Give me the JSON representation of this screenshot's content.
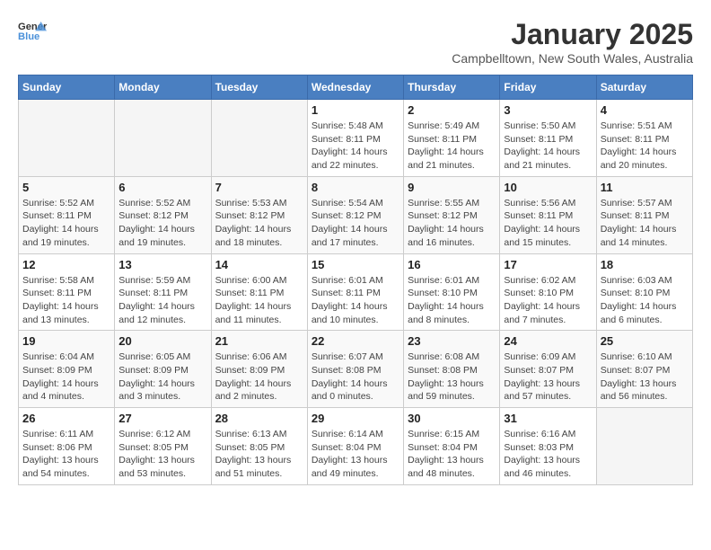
{
  "header": {
    "logo_line1": "General",
    "logo_line2": "Blue",
    "month_year": "January 2025",
    "location": "Campbelltown, New South Wales, Australia"
  },
  "days_of_week": [
    "Sunday",
    "Monday",
    "Tuesday",
    "Wednesday",
    "Thursday",
    "Friday",
    "Saturday"
  ],
  "weeks": [
    [
      {
        "day": "",
        "info": ""
      },
      {
        "day": "",
        "info": ""
      },
      {
        "day": "",
        "info": ""
      },
      {
        "day": "1",
        "info": "Sunrise: 5:48 AM\nSunset: 8:11 PM\nDaylight: 14 hours\nand 22 minutes."
      },
      {
        "day": "2",
        "info": "Sunrise: 5:49 AM\nSunset: 8:11 PM\nDaylight: 14 hours\nand 21 minutes."
      },
      {
        "day": "3",
        "info": "Sunrise: 5:50 AM\nSunset: 8:11 PM\nDaylight: 14 hours\nand 21 minutes."
      },
      {
        "day": "4",
        "info": "Sunrise: 5:51 AM\nSunset: 8:11 PM\nDaylight: 14 hours\nand 20 minutes."
      }
    ],
    [
      {
        "day": "5",
        "info": "Sunrise: 5:52 AM\nSunset: 8:11 PM\nDaylight: 14 hours\nand 19 minutes."
      },
      {
        "day": "6",
        "info": "Sunrise: 5:52 AM\nSunset: 8:12 PM\nDaylight: 14 hours\nand 19 minutes."
      },
      {
        "day": "7",
        "info": "Sunrise: 5:53 AM\nSunset: 8:12 PM\nDaylight: 14 hours\nand 18 minutes."
      },
      {
        "day": "8",
        "info": "Sunrise: 5:54 AM\nSunset: 8:12 PM\nDaylight: 14 hours\nand 17 minutes."
      },
      {
        "day": "9",
        "info": "Sunrise: 5:55 AM\nSunset: 8:12 PM\nDaylight: 14 hours\nand 16 minutes."
      },
      {
        "day": "10",
        "info": "Sunrise: 5:56 AM\nSunset: 8:11 PM\nDaylight: 14 hours\nand 15 minutes."
      },
      {
        "day": "11",
        "info": "Sunrise: 5:57 AM\nSunset: 8:11 PM\nDaylight: 14 hours\nand 14 minutes."
      }
    ],
    [
      {
        "day": "12",
        "info": "Sunrise: 5:58 AM\nSunset: 8:11 PM\nDaylight: 14 hours\nand 13 minutes."
      },
      {
        "day": "13",
        "info": "Sunrise: 5:59 AM\nSunset: 8:11 PM\nDaylight: 14 hours\nand 12 minutes."
      },
      {
        "day": "14",
        "info": "Sunrise: 6:00 AM\nSunset: 8:11 PM\nDaylight: 14 hours\nand 11 minutes."
      },
      {
        "day": "15",
        "info": "Sunrise: 6:01 AM\nSunset: 8:11 PM\nDaylight: 14 hours\nand 10 minutes."
      },
      {
        "day": "16",
        "info": "Sunrise: 6:01 AM\nSunset: 8:10 PM\nDaylight: 14 hours\nand 8 minutes."
      },
      {
        "day": "17",
        "info": "Sunrise: 6:02 AM\nSunset: 8:10 PM\nDaylight: 14 hours\nand 7 minutes."
      },
      {
        "day": "18",
        "info": "Sunrise: 6:03 AM\nSunset: 8:10 PM\nDaylight: 14 hours\nand 6 minutes."
      }
    ],
    [
      {
        "day": "19",
        "info": "Sunrise: 6:04 AM\nSunset: 8:09 PM\nDaylight: 14 hours\nand 4 minutes."
      },
      {
        "day": "20",
        "info": "Sunrise: 6:05 AM\nSunset: 8:09 PM\nDaylight: 14 hours\nand 3 minutes."
      },
      {
        "day": "21",
        "info": "Sunrise: 6:06 AM\nSunset: 8:09 PM\nDaylight: 14 hours\nand 2 minutes."
      },
      {
        "day": "22",
        "info": "Sunrise: 6:07 AM\nSunset: 8:08 PM\nDaylight: 14 hours\nand 0 minutes."
      },
      {
        "day": "23",
        "info": "Sunrise: 6:08 AM\nSunset: 8:08 PM\nDaylight: 13 hours\nand 59 minutes."
      },
      {
        "day": "24",
        "info": "Sunrise: 6:09 AM\nSunset: 8:07 PM\nDaylight: 13 hours\nand 57 minutes."
      },
      {
        "day": "25",
        "info": "Sunrise: 6:10 AM\nSunset: 8:07 PM\nDaylight: 13 hours\nand 56 minutes."
      }
    ],
    [
      {
        "day": "26",
        "info": "Sunrise: 6:11 AM\nSunset: 8:06 PM\nDaylight: 13 hours\nand 54 minutes."
      },
      {
        "day": "27",
        "info": "Sunrise: 6:12 AM\nSunset: 8:05 PM\nDaylight: 13 hours\nand 53 minutes."
      },
      {
        "day": "28",
        "info": "Sunrise: 6:13 AM\nSunset: 8:05 PM\nDaylight: 13 hours\nand 51 minutes."
      },
      {
        "day": "29",
        "info": "Sunrise: 6:14 AM\nSunset: 8:04 PM\nDaylight: 13 hours\nand 49 minutes."
      },
      {
        "day": "30",
        "info": "Sunrise: 6:15 AM\nSunset: 8:04 PM\nDaylight: 13 hours\nand 48 minutes."
      },
      {
        "day": "31",
        "info": "Sunrise: 6:16 AM\nSunset: 8:03 PM\nDaylight: 13 hours\nand 46 minutes."
      },
      {
        "day": "",
        "info": ""
      }
    ]
  ]
}
